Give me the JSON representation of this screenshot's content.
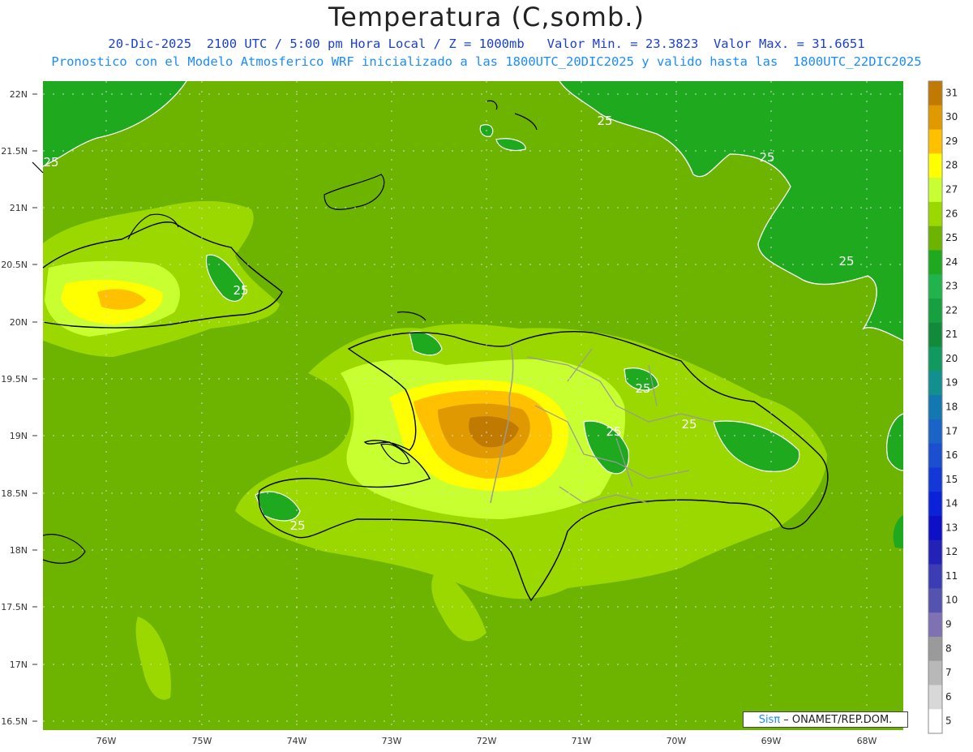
{
  "title": "Temperatura (C,somb.)",
  "subtitle_line1": "20-Dic-2025  2100 UTC / 5:00 pm Hora Local / Z = 1000mb   Valor Min. = 23.3823  Valor Max. = 31.6651",
  "subtitle_line2": "Pronostico con el Modelo Atmosferico WRF inicializado a las 1800UTC_20DIC2025 y valido hasta las  1800UTC_22DIC2025",
  "credit": {
    "sis": "Sisπ",
    "org": " – ONAMET/REP.DOM."
  },
  "lat_labels": [
    "22N",
    "21.5N",
    "21N",
    "20.5N",
    "20N",
    "19.5N",
    "19N",
    "18.5N",
    "18N",
    "17.5N",
    "17N",
    "16.5N"
  ],
  "lon_labels": [
    "76W",
    "75W",
    "74W",
    "73W",
    "72W",
    "71W",
    "70W",
    "69W",
    "68W"
  ],
  "colorbar": {
    "labels": [
      "31",
      "30",
      "29",
      "28",
      "27",
      "26",
      "25",
      "24",
      "23",
      "22",
      "21",
      "20",
      "19",
      "18",
      "17",
      "16",
      "15",
      "14",
      "13",
      "12",
      "11",
      "10",
      "9",
      "8",
      "7",
      "6",
      "5"
    ],
    "colors": [
      "#c07a00",
      "#e09a00",
      "#ffc000",
      "#ffff00",
      "#c8ff30",
      "#9ad800",
      "#6cb400",
      "#1ea91e",
      "#22b44c",
      "#17a040",
      "#128a3c",
      "#109a60",
      "#129090",
      "#1478b0",
      "#1a64c8",
      "#1a50d0",
      "#1438d8",
      "#0c22d8",
      "#0e10c8",
      "#2222b8",
      "#3c3cb4",
      "#5454b0",
      "#8070b4",
      "#9a9a9a",
      "#b8b8b8",
      "#d8d8d8",
      "#ffffff"
    ]
  },
  "contour_labels": [
    "25",
    "25",
    "25",
    "25",
    "25",
    "25",
    "25",
    "25",
    "25"
  ],
  "colors": {
    "sea": "#6cb400",
    "cool": "#1ea91e",
    "warm26": "#9ad800",
    "warm27": "#c8ff30",
    "warm28": "#ffff00",
    "warm29": "#ffc000",
    "warm30": "#e09a00",
    "warm31": "#c07a00"
  }
}
